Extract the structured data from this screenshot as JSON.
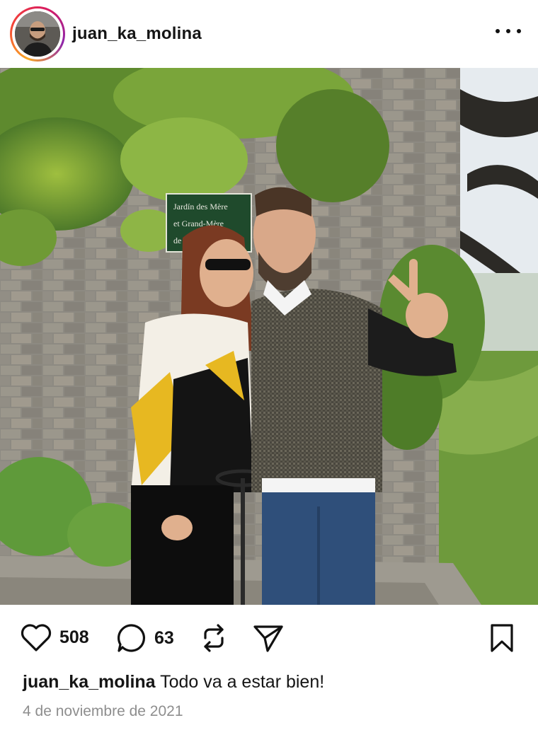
{
  "post": {
    "username": "juan_ka_molina",
    "likes": "508",
    "comments": "63",
    "caption_user": "juan_ka_molina",
    "caption_text": "Todo va a estar bien!",
    "date": "4 de noviembre de 2021"
  },
  "photo": {
    "sign_lines": [
      "Jardín des Mère",
      "et Grand-Mère",
      "de la"
    ]
  },
  "icons": {
    "more": "more-options-icon",
    "like": "heart-icon",
    "comment": "comment-icon",
    "repost": "repost-icon",
    "share": "send-icon",
    "save": "bookmark-icon"
  }
}
